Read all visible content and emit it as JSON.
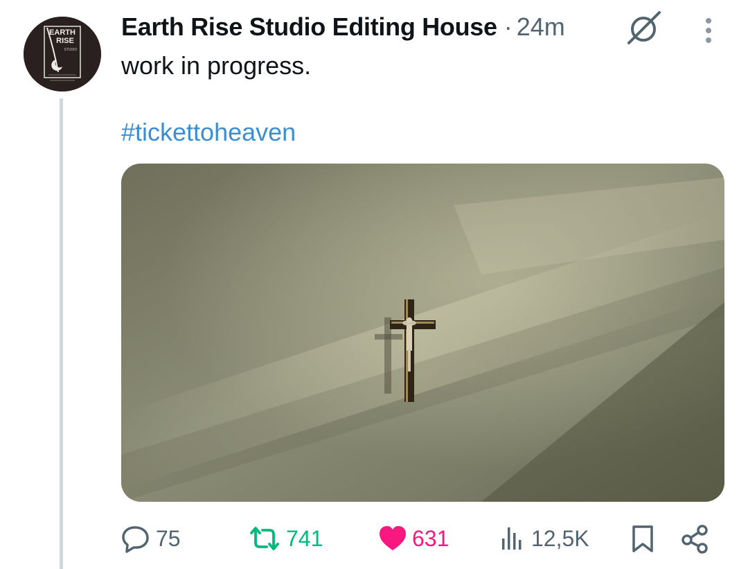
{
  "post": {
    "author": {
      "display_name": "Earth Rise Studio Editing House",
      "avatar_icon": "earth-rise-studio-logo",
      "avatar_logo_text": [
        "EARTH",
        "RISE",
        "STUDIO"
      ]
    },
    "separator": "·",
    "time": "24m",
    "text": "work in progress.",
    "hashtag": "#tickettoheaven",
    "media": {
      "type": "photo",
      "icon": "crucifix-on-wall-photo"
    },
    "actions": {
      "reply": {
        "icon": "reply-icon",
        "count": "75"
      },
      "retweet": {
        "icon": "retweet-icon",
        "count": "741",
        "color": "#00ba7c"
      },
      "like": {
        "icon": "heart-icon",
        "count": "631",
        "color": "#f91880",
        "liked": true
      },
      "views": {
        "icon": "views-icon",
        "count": "12,5K"
      },
      "bookmark": {
        "icon": "bookmark-icon"
      },
      "share": {
        "icon": "share-icon"
      }
    },
    "header_icons": {
      "grok": "grok-icon",
      "more": "more-options-icon"
    }
  },
  "colors": {
    "text": "#0f1419",
    "secondary": "#536471",
    "hashtag": "#3b8fd1",
    "thread_line": "#cfd9de"
  }
}
